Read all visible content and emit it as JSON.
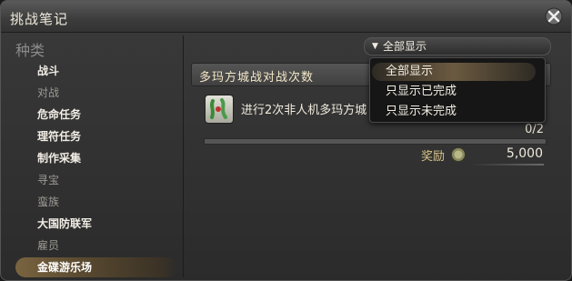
{
  "window": {
    "title": "挑战笔记"
  },
  "sidebar": {
    "title": "种类",
    "items": [
      {
        "label": "战斗",
        "style": "strong"
      },
      {
        "label": "对战",
        "style": "dim"
      },
      {
        "label": "危命任务",
        "style": "strong"
      },
      {
        "label": "理符任务",
        "style": "strong"
      },
      {
        "label": "制作采集",
        "style": "strong"
      },
      {
        "label": "寻宝",
        "style": "dim"
      },
      {
        "label": "蛮族",
        "style": "dim"
      },
      {
        "label": "大国防联军",
        "style": "strong"
      },
      {
        "label": "雇员",
        "style": "dim"
      },
      {
        "label": "金碟游乐场",
        "style": "selected"
      }
    ]
  },
  "filter": {
    "selected": "全部显示",
    "options": [
      "全部显示",
      "只显示已完成",
      "只显示未完成"
    ]
  },
  "section": {
    "title": "多玛方城战对战次数"
  },
  "task": {
    "text": "进行2次非人机多玛方城",
    "progress_text": "0/2",
    "progress": 0.0
  },
  "reward": {
    "label": "奖励",
    "value": "5,000"
  }
}
